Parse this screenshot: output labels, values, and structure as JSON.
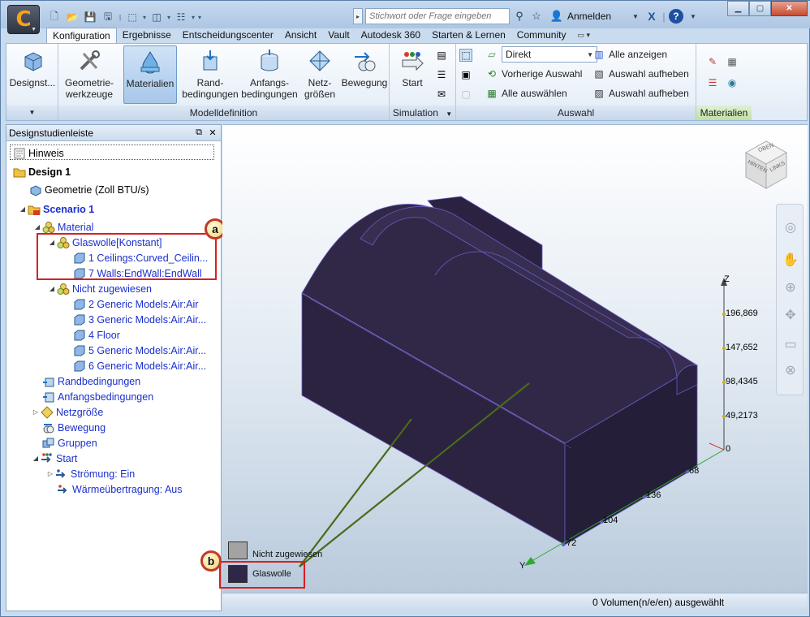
{
  "window": {
    "search_placeholder": "Stichwort oder Frage eingeben",
    "signin_label": "Anmelden"
  },
  "tabs": [
    "Konfiguration",
    "Ergebnisse",
    "Entscheidungscenter",
    "Ansicht",
    "Vault",
    "Autodesk 360",
    "Starten & Lernen",
    "Community"
  ],
  "ribbon": {
    "designst": "Designst...",
    "geometrie_line1": "Geometrie-",
    "geometrie_line2": "werkzeuge",
    "materialien": "Materialien",
    "rand_line1": "Rand-",
    "rand_line2": "bedingungen",
    "anfangs_line1": "Anfangs-",
    "anfangs_line2": "bedingungen",
    "netz_line1": "Netz-",
    "netz_line2": "größen",
    "bewegung": "Bewegung",
    "start": "Start",
    "group_modelldefinition": "Modelldefinition",
    "group_simulation": "Simulation",
    "group_auswahl": "Auswahl",
    "group_materialien": "Materialien",
    "direkt": "Direkt",
    "vorherige_auswahl": "Vorherige Auswahl",
    "alle_auswaehlen": "Alle auswählen",
    "alle_anzeigen": "Alle anzeigen",
    "auswahl_aufheben_1": "Auswahl aufheben",
    "auswahl_aufheben_2": "Auswahl aufheben"
  },
  "panel": {
    "title": "Designstudienleiste",
    "tree": {
      "hinweis": "Hinweis",
      "design": "Design 1",
      "geometrie": "Geometrie (Zoll BTU/s)",
      "scenario": "Scenario 1",
      "material": "Material",
      "glaswolle": "Glaswolle[Konstant]",
      "item1": "1 Ceilings:Curved_Ceilin...",
      "item7": "7 Walls:EndWall:EndWall",
      "nicht_zugewiesen": "Nicht zugewiesen",
      "item2": "2 Generic Models:Air:Air",
      "item3": "3 Generic Models:Air:Air...",
      "item4": "4 Floor",
      "item5": "5 Generic Models:Air:Air...",
      "item6": "6 Generic Models:Air:Air...",
      "randbedingungen": "Randbedingungen",
      "anfangsbedingungen": "Anfangsbedingungen",
      "netzgroesse": "Netzgröße",
      "bewegung": "Bewegung",
      "gruppen": "Gruppen",
      "start": "Start",
      "stroemung": "Strömung: Ein",
      "waerme": "Wärmeübertragung: Aus"
    }
  },
  "viewport": {
    "viewcube_top": "OBEN",
    "viewcube_left": "HINTEN",
    "viewcube_right": "LINKS",
    "axis_z_label": "Z",
    "axis_y_label": "Y",
    "z_ticks": [
      "196,869",
      "147,652",
      "98,4345",
      "49,2173",
      "0"
    ],
    "y_ticks": [
      "72",
      "104",
      "136",
      "68"
    ],
    "legend": [
      {
        "label": "Nicht zugewiesen",
        "color": "#a3a3a3"
      },
      {
        "label": "Glaswolle",
        "color": "#2f2748"
      }
    ],
    "model_color": "#2c2440",
    "leader_color": "#4a6a1a"
  },
  "callouts": {
    "a": "a",
    "b": "b"
  },
  "status": "0 Volumen(n/e/en) ausgewählt"
}
